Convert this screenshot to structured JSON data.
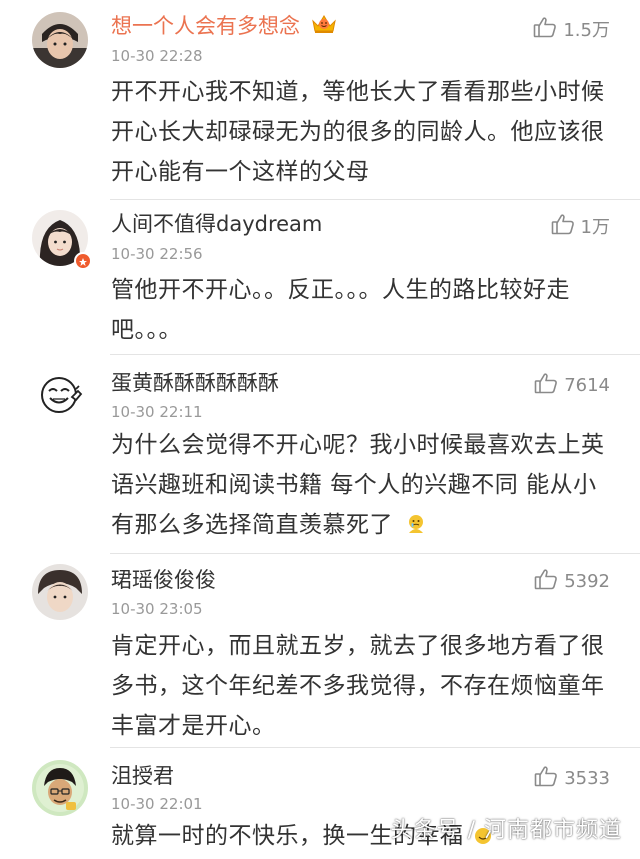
{
  "comments": [
    {
      "username": "想一个人会有多想念",
      "time": "10-30 22:28",
      "likes": "1.5万",
      "text": "开不开心我不知道，等他长大了看看那些小时候开心长大却碌碌无为的很多的同龄人。他应该很开心能有一个这样的父母",
      "vip_icon": "crown-vip-icon"
    },
    {
      "username": "人间不值得daydream",
      "time": "10-30 22:56",
      "likes": "1万",
      "text": "管他开不开心。。反正。。。人生的路比较好走吧。。。"
    },
    {
      "username": "蛋黄酥酥酥酥酥酥",
      "time": "10-30 22:11",
      "likes": "7614",
      "text": "为什么会觉得不开心呢？我小时候最喜欢去上英语兴趣班和阅读书籍 每个人的兴趣不同 能从小有那么多选择简直羡慕死了",
      "emoji": "crying-emoji-icon"
    },
    {
      "username": "珺瑶俊俊俊",
      "time": "10-30 23:05",
      "likes": "5392",
      "text": "肯定开心，而且就五岁，就去了很多地方看了很多书，这个年纪差不多我觉得，不存在烦恼童年丰富才是开心。"
    },
    {
      "username": "沮授君",
      "time": "10-30 22:01",
      "likes": "3533",
      "text": "就算一时的不快乐，换一生的幸福"
    }
  ],
  "watermark": "头条号 / 河南都市频道",
  "colors": {
    "vip_name": "#eb7350",
    "name": "#333333",
    "time": "#999999",
    "like": "#8a8a8a"
  }
}
